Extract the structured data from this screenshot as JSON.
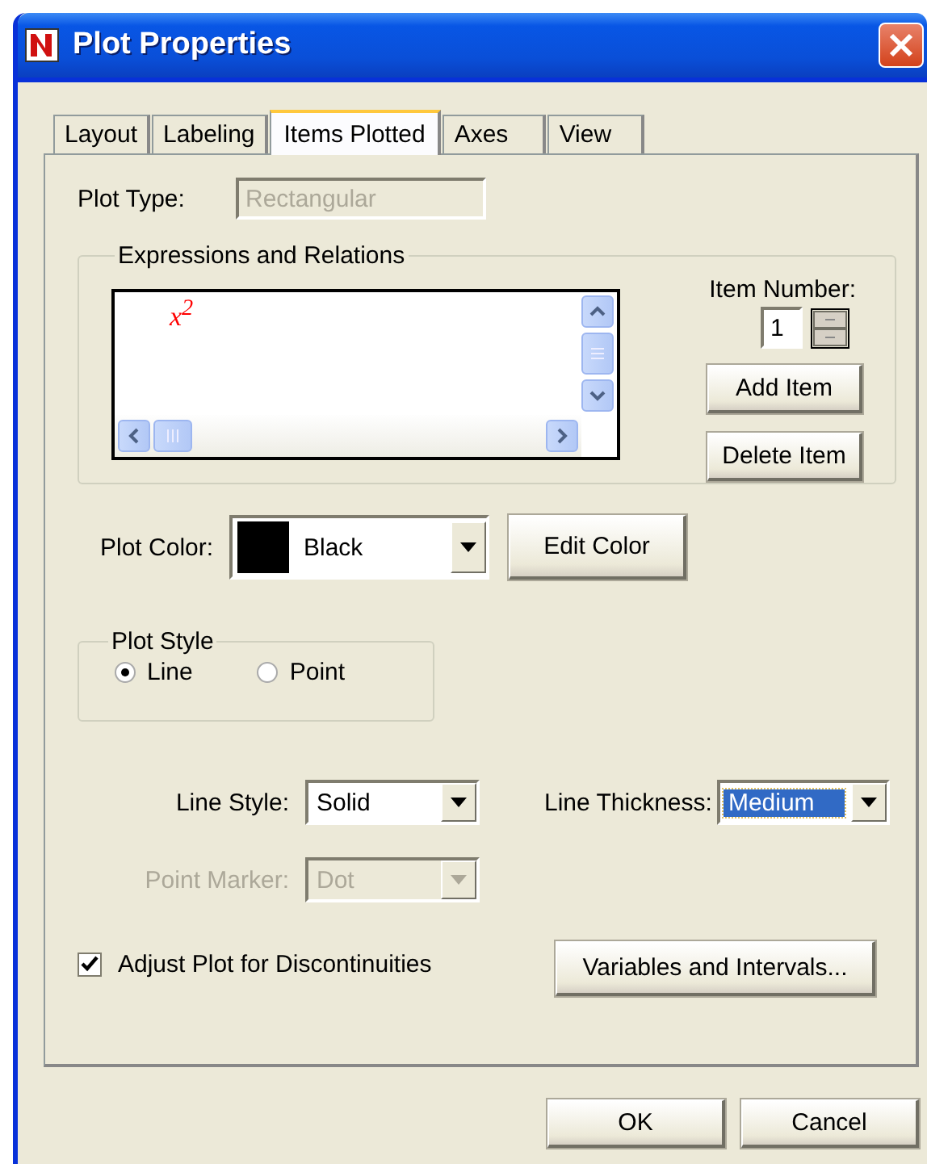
{
  "window": {
    "title": "Plot Properties"
  },
  "tabs": [
    {
      "label": "Layout",
      "selected": false
    },
    {
      "label": "Labeling",
      "selected": false
    },
    {
      "label": "Items Plotted",
      "selected": true
    },
    {
      "label": "Axes",
      "selected": false
    },
    {
      "label": "View",
      "selected": false
    }
  ],
  "plot_type": {
    "label": "Plot Type:",
    "value": "Rectangular",
    "disabled": true
  },
  "expressions": {
    "title": "Expressions and Relations",
    "items": [
      {
        "text": "x$^{2}$"
      }
    ],
    "item_number": {
      "label": "Item Number:",
      "value": "1"
    },
    "buttons": [
      {
        "label": "Add Item"
      },
      {
        "label": "Delete Item"
      }
    ]
  },
  "plot_color": {
    "label": "Plot Color:",
    "value": "Black",
    "color": "#000000",
    "button": {
      "label": "Edit Color"
    }
  },
  "plot_style": {
    "title": "Plot Style",
    "options": [
      {
        "label": "Line",
        "selected": true
      },
      {
        "label": "Point",
        "selected": false
      }
    ]
  },
  "line_style": {
    "label": "Line Style:",
    "value": "Solid",
    "disabled": false,
    "focused": false
  },
  "line_thickness": {
    "label": "Line Thickness:",
    "value": "Medium",
    "disabled": false,
    "focused": true
  },
  "point_marker": {
    "label": "Point Marker:",
    "value": "Dot",
    "disabled": true,
    "focused": false
  },
  "adjust": {
    "label": "Adjust Plot for Discontinuities",
    "checked": true
  },
  "variables_button": {
    "label": "Variables and Intervals..."
  },
  "buttons": [
    {
      "label": "OK"
    },
    {
      "label": "Cancel"
    }
  ]
}
